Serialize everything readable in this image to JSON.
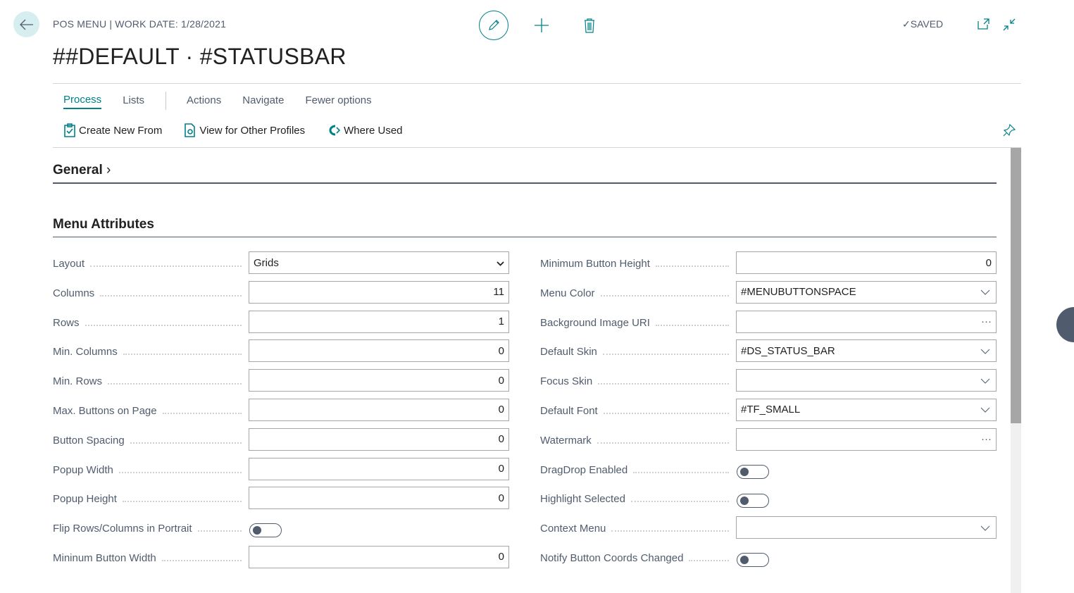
{
  "header": {
    "breadcrumb": "POS MENU | WORK DATE: 1/28/2021",
    "title": "##DEFAULT · #STATUSBAR",
    "status": "SAVED"
  },
  "tabs": [
    "Process",
    "Lists",
    "Actions",
    "Navigate",
    "Fewer options"
  ],
  "actions": [
    "Create New From",
    "View for Other Profiles",
    "Where Used"
  ],
  "sections": {
    "general": "General",
    "menu_attributes": "Menu Attributes"
  },
  "left_fields": [
    {
      "label": "Layout",
      "type": "select",
      "value": "Grids"
    },
    {
      "label": "Columns",
      "type": "number",
      "value": "11"
    },
    {
      "label": "Rows",
      "type": "number",
      "value": "1"
    },
    {
      "label": "Min. Columns",
      "type": "number",
      "value": "0"
    },
    {
      "label": "Min. Rows",
      "type": "number",
      "value": "0"
    },
    {
      "label": "Max. Buttons on Page",
      "type": "number",
      "value": "0"
    },
    {
      "label": "Button Spacing",
      "type": "number",
      "value": "0"
    },
    {
      "label": "Popup Width",
      "type": "number",
      "value": "0"
    },
    {
      "label": "Popup Height",
      "type": "number",
      "value": "0"
    },
    {
      "label": "Flip Rows/Columns in Portrait",
      "type": "toggle",
      "value": false
    },
    {
      "label": "Mininum Button Width",
      "type": "number",
      "value": "0"
    }
  ],
  "right_fields": [
    {
      "label": "Minimum Button Height",
      "type": "number",
      "value": "0"
    },
    {
      "label": "Menu Color",
      "type": "lookup",
      "value": "#MENUBUTTONSPACE"
    },
    {
      "label": "Background Image URI",
      "type": "assist",
      "value": ""
    },
    {
      "label": "Default Skin",
      "type": "lookup",
      "value": "#DS_STATUS_BAR"
    },
    {
      "label": "Focus Skin",
      "type": "lookup",
      "value": ""
    },
    {
      "label": "Default Font",
      "type": "lookup",
      "value": "#TF_SMALL"
    },
    {
      "label": "Watermark",
      "type": "assist",
      "value": ""
    },
    {
      "label": "DragDrop Enabled",
      "type": "toggle",
      "value": false
    },
    {
      "label": "Highlight Selected",
      "type": "toggle",
      "value": false
    },
    {
      "label": "Context Menu",
      "type": "lookup",
      "value": ""
    },
    {
      "label": "Notify Button Coords Changed",
      "type": "toggle",
      "value": false
    }
  ],
  "colors": {
    "accent": "#00818a",
    "text": "#505c6d"
  }
}
